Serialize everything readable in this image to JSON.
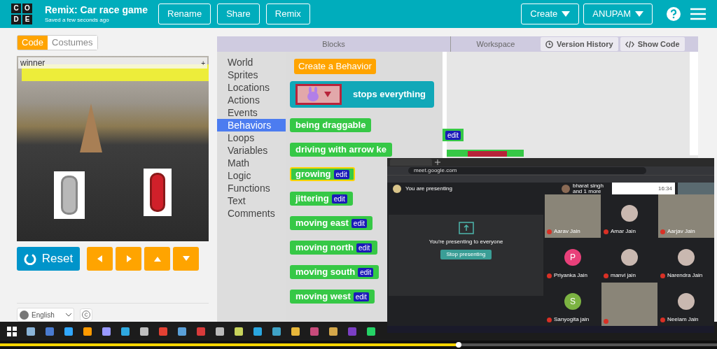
{
  "header": {
    "logo_letters": [
      "C",
      "O",
      "D",
      "E"
    ],
    "title": "Remix: Car race game",
    "subtitle": "Saved a few seconds ago",
    "buttons": [
      "Rename",
      "Share",
      "Remix"
    ],
    "menus": [
      "Create",
      "ANUPAM"
    ]
  },
  "mode_tabs": [
    {
      "label": "Code",
      "selected": true
    },
    {
      "label": "Costumes",
      "selected": false
    }
  ],
  "stage": {
    "text_label": "winner",
    "corner_mark": "+"
  },
  "reset_button": "Reset",
  "arrow_buttons": [
    {
      "kind": "left"
    },
    {
      "kind": "right"
    },
    {
      "kind": "up"
    },
    {
      "kind": "down"
    }
  ],
  "language": "English",
  "panel_headers": [
    "Blocks",
    "Workspace"
  ],
  "toolbar_buttons": [
    {
      "kind": "history",
      "label": "Version History"
    },
    {
      "kind": "code",
      "label": "Show Code"
    }
  ],
  "categories": [
    {
      "label": "World",
      "selected": false
    },
    {
      "label": "Sprites",
      "selected": false
    },
    {
      "label": "Locations",
      "selected": false
    },
    {
      "label": "Actions",
      "selected": false
    },
    {
      "label": "Events",
      "selected": false
    },
    {
      "label": "Behaviors",
      "selected": true
    },
    {
      "label": "Loops",
      "selected": false
    },
    {
      "label": "Variables",
      "selected": false
    },
    {
      "label": "Math",
      "selected": false
    },
    {
      "label": "Logic",
      "selected": false
    },
    {
      "label": "Functions",
      "selected": false
    },
    {
      "label": "Text",
      "selected": false
    },
    {
      "label": "Comments",
      "selected": false
    }
  ],
  "create_button": "Create a Behavior",
  "blocks": [
    {
      "kind": "sprite",
      "label": "stops everything",
      "highlighted": false
    },
    {
      "kind": "plain",
      "label": "being draggable",
      "highlighted": false
    },
    {
      "kind": "plain",
      "label": "driving with arrow ke",
      "highlighted": false
    },
    {
      "kind": "edit",
      "label": "growing",
      "edit": "edit",
      "highlighted": true
    },
    {
      "kind": "edit",
      "label": "jittering",
      "edit": "edit",
      "highlighted": false
    },
    {
      "kind": "edit",
      "label": "moving east",
      "edit": "edit",
      "highlighted": false
    },
    {
      "kind": "edit",
      "label": "moving north",
      "edit": "edit",
      "highlighted": false
    },
    {
      "kind": "edit",
      "label": "moving south",
      "edit": "edit",
      "highlighted": false
    },
    {
      "kind": "edit",
      "label": "moving west",
      "edit": "edit",
      "highlighted": false
    }
  ],
  "workspace": {
    "edit_tag": "edit"
  },
  "meet": {
    "address": "meet.google.com",
    "presenting": "You are presenting",
    "others": [
      "bharat singh",
      "and 1 more"
    ],
    "clock": "16:34",
    "share_message": "You're presenting to everyone",
    "stop_button": "Stop presenting",
    "tiles": [
      {
        "kind": "video",
        "name": "Aarav Jain"
      },
      {
        "kind": "photo",
        "name": "Amar Jain"
      },
      {
        "kind": "video",
        "name": "Aarjav Jain"
      },
      {
        "kind": "letter",
        "letter": "P",
        "color": "#e8407a",
        "name": "Priyanka Jain"
      },
      {
        "kind": "photo",
        "name": "manvi jain"
      },
      {
        "kind": "photo",
        "name": "Narendra Jain"
      },
      {
        "kind": "letter",
        "letter": "S",
        "color": "#7cb342",
        "name": "Sanyogita jain"
      },
      {
        "kind": "video"
      },
      {
        "kind": "photo",
        "name": "Neelam Jain"
      }
    ]
  },
  "video_progress": {
    "level": 0.64
  }
}
